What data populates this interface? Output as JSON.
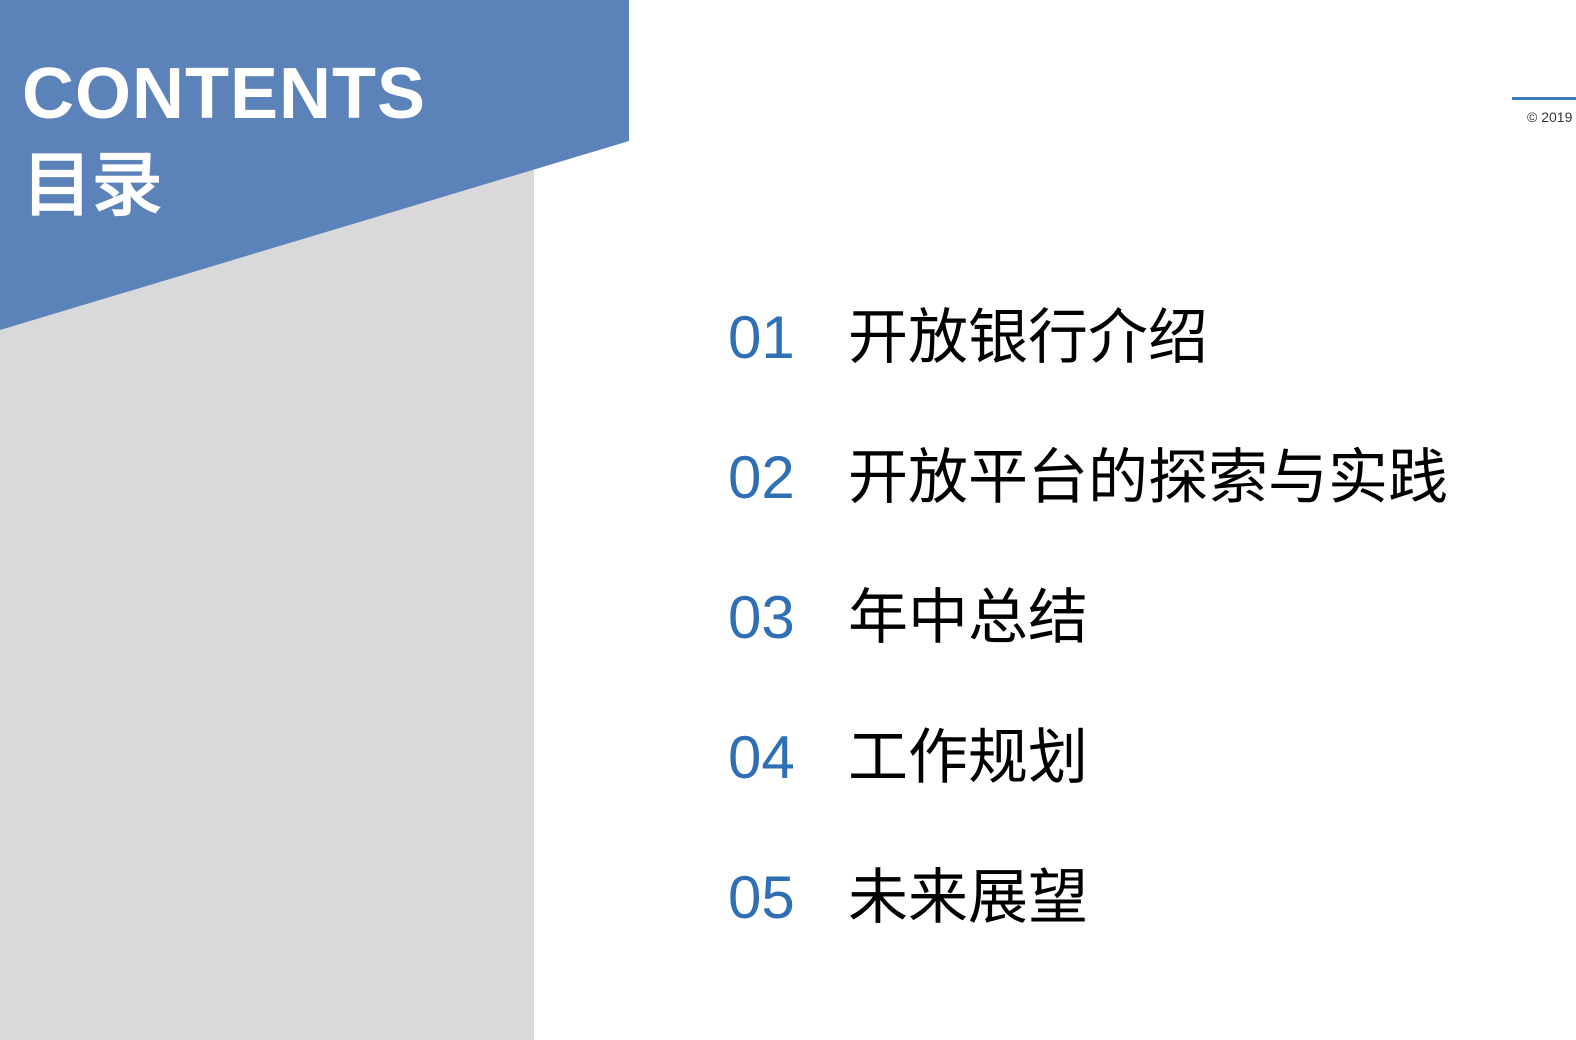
{
  "header": {
    "title_en": "CONTENTS",
    "title_zh": "目录"
  },
  "copyright": "© 2019",
  "colors": {
    "banner": "#5b82b9",
    "panel": "#d9d9d9",
    "accent": "#2e6fb5"
  },
  "toc": [
    {
      "number": "01",
      "title": "开放银行介绍"
    },
    {
      "number": "02",
      "title": "开放平台的探索与实践"
    },
    {
      "number": "03",
      "title": "年中总结"
    },
    {
      "number": "04",
      "title": "工作规划"
    },
    {
      "number": "05",
      "title": "未来展望"
    }
  ]
}
